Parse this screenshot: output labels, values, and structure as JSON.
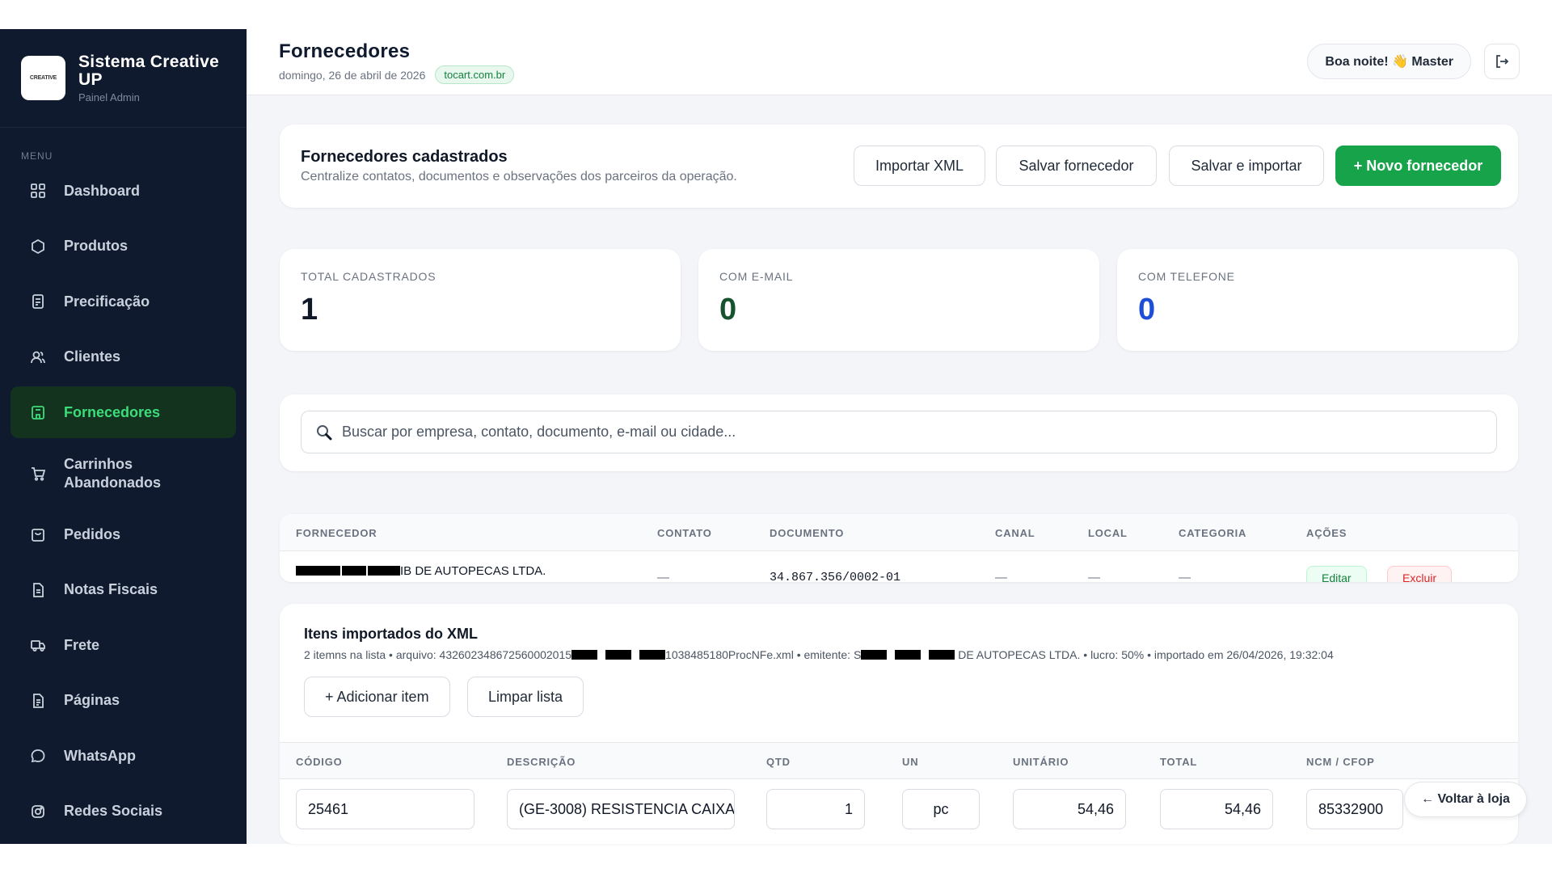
{
  "brand": {
    "title": "Sistema Creative UP",
    "subtitle": "Painel Admin",
    "logo_text": "CREATIVE"
  },
  "menu_label": "MENU",
  "nav": [
    {
      "label": "Dashboard",
      "icon": "grid-icon"
    },
    {
      "label": "Produtos",
      "icon": "box-icon"
    },
    {
      "label": "Precificação",
      "icon": "calculator-icon"
    },
    {
      "label": "Clientes",
      "icon": "users-icon"
    },
    {
      "label": "Fornecedores",
      "icon": "building-icon",
      "active": true
    },
    {
      "label": "Carrinhos Abandonados",
      "icon": "cart-icon"
    },
    {
      "label": "Pedidos",
      "icon": "bag-icon"
    },
    {
      "label": "Notas Fiscais",
      "icon": "document-icon"
    },
    {
      "label": "Frete",
      "icon": "truck-icon"
    },
    {
      "label": "Páginas",
      "icon": "page-icon"
    },
    {
      "label": "WhatsApp",
      "icon": "chat-icon"
    },
    {
      "label": "Redes Sociais",
      "icon": "instagram-icon"
    }
  ],
  "header": {
    "title": "Fornecedores",
    "date": "domingo, 26 de abril de 2026",
    "domain": "tocart.com.br",
    "greeting": "Boa noite! 👋 Master"
  },
  "intro": {
    "title": "Fornecedores cadastrados",
    "subtitle": "Centralize contatos, documentos e observações dos parceiros da operação.",
    "btn_import": "Importar XML",
    "btn_save": "Salvar fornecedor",
    "btn_save_import": "Salvar e importar",
    "btn_new": "+ Novo fornecedor"
  },
  "stats": [
    {
      "label": "TOTAL CADASTRADOS",
      "value": "1",
      "color": "#111827"
    },
    {
      "label": "COM E-MAIL",
      "value": "0",
      "color": "#14532d"
    },
    {
      "label": "COM TELEFONE",
      "value": "0",
      "color": "#1d4ed8"
    }
  ],
  "search": {
    "placeholder": "Buscar por empresa, contato, documento, e-mail ou cidade..."
  },
  "suppliers_table": {
    "columns": [
      "FORNECEDOR",
      "CONTATO",
      "DOCUMENTO",
      "CANAL",
      "LOCAL",
      "CATEGORIA",
      "AÇÕES"
    ],
    "row": {
      "name_suffix": "IB DE AUTOPECAS LTDA.",
      "contato": "—",
      "documento": "34.867.356/0002-01",
      "canal": "—",
      "local": "—",
      "categoria": "—",
      "edit": "Editar",
      "delete": "Excluir"
    }
  },
  "xml_items": {
    "title": "Itens importados do XML",
    "meta_a": "2 itemns na lista • arquivo: 432602348672560002015",
    "meta_b": "1038485180ProcNFe.xml • emitente: S",
    "meta_c": " DE AUTOPECAS LTDA. • lucro: 50% • importado em 26/04/2026, 19:32:04",
    "btn_add": "+ Adicionar item",
    "btn_clear": "Limpar lista",
    "columns": [
      "CÓDIGO",
      "DESCRIÇÃO",
      "QTD",
      "UN",
      "UNITÁRIO",
      "TOTAL",
      "NCM / CFOP"
    ],
    "row": {
      "codigo": "25461",
      "descricao": "(GE-3008) RESISTENCIA CAIXA",
      "qtd": "1",
      "un": "pc",
      "unitario": "54,46",
      "total": "54,46",
      "ncm": "85332900"
    }
  },
  "back_button": "← Voltar à loja"
}
